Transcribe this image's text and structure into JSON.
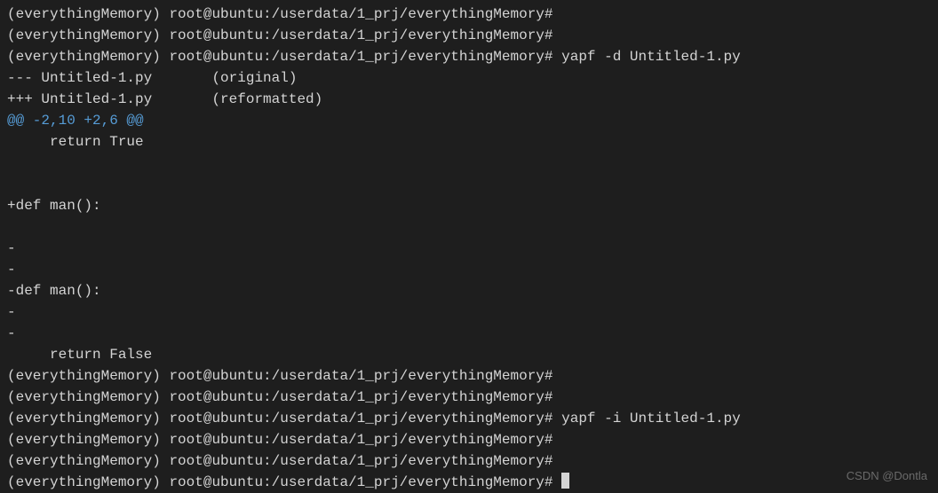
{
  "terminal": {
    "lines": [
      {
        "prefix": "(everythingMemory) ",
        "prompt": "root@ubuntu:/userdata/1_prj/everythingMemory#",
        "cmd": "",
        "hasCursor": false
      },
      {
        "prefix": "(everythingMemory) ",
        "prompt": "root@ubuntu:/userdata/1_prj/everythingMemory#",
        "cmd": "",
        "hasCursor": false
      },
      {
        "prefix": "(everythingMemory) ",
        "prompt": "root@ubuntu:/userdata/1_prj/everythingMemory#",
        "cmd": " yapf -d Untitled-1.py",
        "hasCursor": false
      },
      {
        "text": "--- Untitled-1.py       (original)"
      },
      {
        "text": "+++ Untitled-1.py       (reformatted)"
      },
      {
        "text": "",
        "cyanText": "@@ -2,10 +2,6 @@"
      },
      {
        "text": "     return True"
      },
      {
        "text": " "
      },
      {
        "text": " "
      },
      {
        "text": "+def man():"
      },
      {
        "text": " "
      },
      {
        "text": "-"
      },
      {
        "text": "-"
      },
      {
        "text": "-def man():"
      },
      {
        "text": "-"
      },
      {
        "text": "-"
      },
      {
        "text": "     return False"
      },
      {
        "prefix": "(everythingMemory) ",
        "prompt": "root@ubuntu:/userdata/1_prj/everythingMemory#",
        "cmd": "",
        "hasCursor": false
      },
      {
        "prefix": "(everythingMemory) ",
        "prompt": "root@ubuntu:/userdata/1_prj/everythingMemory#",
        "cmd": "",
        "hasCursor": false
      },
      {
        "prefix": "(everythingMemory) ",
        "prompt": "root@ubuntu:/userdata/1_prj/everythingMemory#",
        "cmd": " yapf -i Untitled-1.py",
        "hasCursor": false
      },
      {
        "prefix": "(everythingMemory) ",
        "prompt": "root@ubuntu:/userdata/1_prj/everythingMemory#",
        "cmd": "",
        "hasCursor": false
      },
      {
        "prefix": "(everythingMemory) ",
        "prompt": "root@ubuntu:/userdata/1_prj/everythingMemory#",
        "cmd": "",
        "hasCursor": false
      },
      {
        "prefix": "(everythingMemory) ",
        "prompt": "root@ubuntu:/userdata/1_prj/everythingMemory#",
        "cmd": " ",
        "hasCursor": true
      }
    ]
  },
  "watermark": "CSDN @Dontla"
}
